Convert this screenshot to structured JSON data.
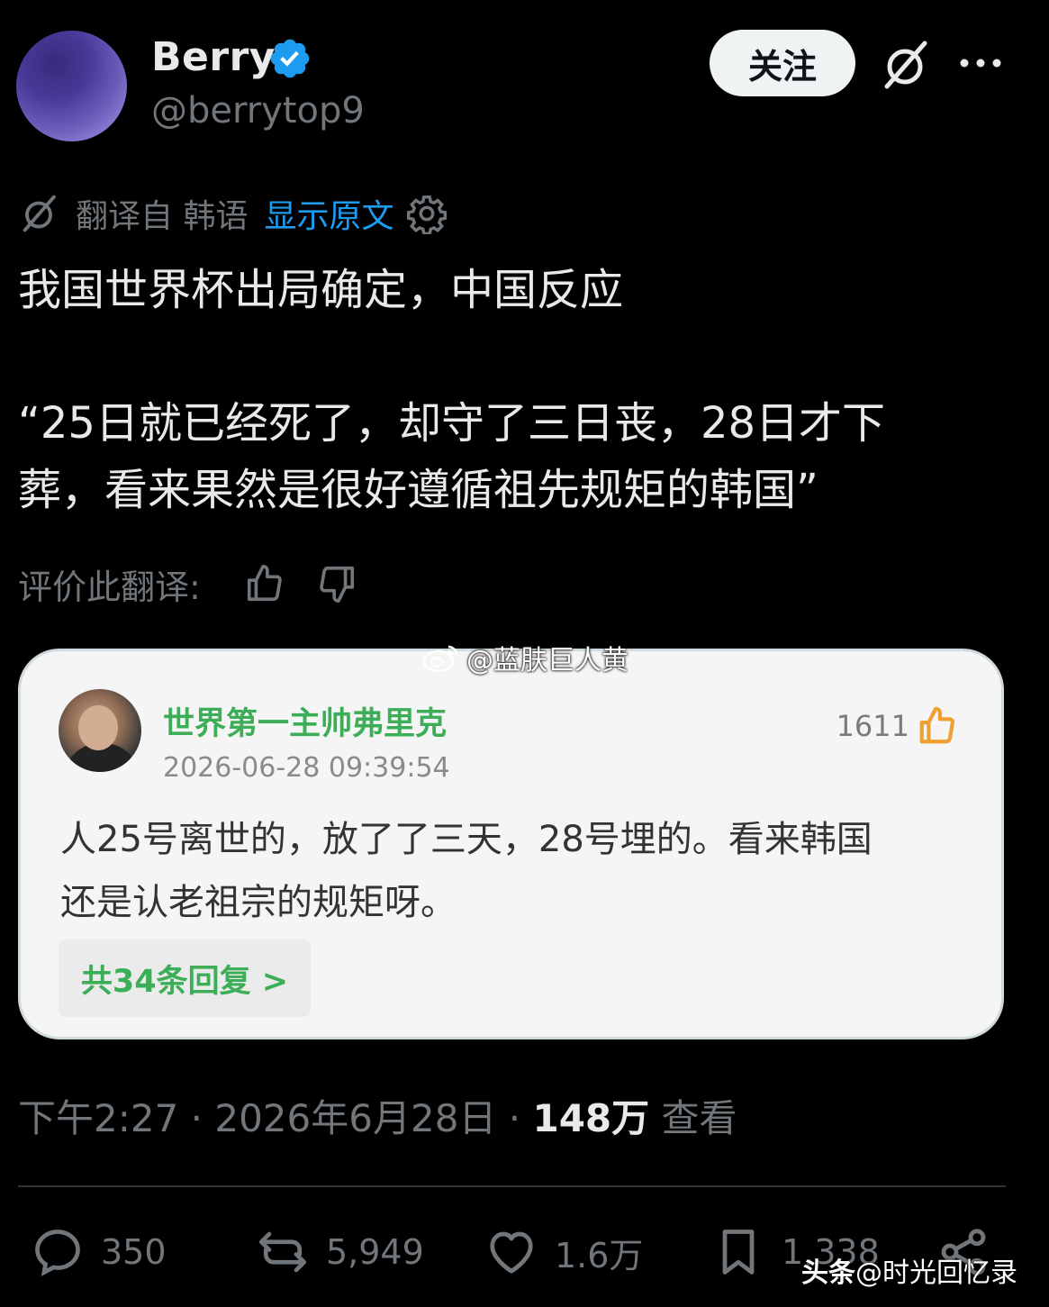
{
  "header": {
    "name": "Berry",
    "handle": "@berrytop9",
    "follow_label": "关注"
  },
  "translation": {
    "label": "翻译自 韩语",
    "show_original": "显示原文"
  },
  "tweet": {
    "lines": [
      "我国世界杯出局确定，中国反应",
      "“25日就已经死了，却守了三日丧，28日才下",
      "葬，看来果然是很好遵循祖先规矩的韩国”"
    ]
  },
  "rate": {
    "label": "评价此翻译:"
  },
  "card": {
    "username": "世界第一主帅弗里克",
    "time": "2026-06-28 09:39:54",
    "likes": "1611",
    "text_lines": [
      "人25号离世的，放了了三天，28号埋的。看来韩国",
      "还是认老祖宗的规矩呀。"
    ],
    "reply_label": "共34条回复 >"
  },
  "meta": {
    "time": "下午2:27 · 2026年6月28日 · ",
    "views": "148万",
    "views_label": " 查看"
  },
  "actions": {
    "replies": "350",
    "reposts": "5,949",
    "likes": "1.6万",
    "bookmarks": "1,338"
  },
  "watermarks": {
    "weibo": "@蓝肤巨人黄",
    "toutiao_brand": "头条",
    "toutiao_user": "@时光回忆录"
  },
  "colors": {
    "background": "#000000",
    "link_blue": "#1d9bf0",
    "muted": "#71767b",
    "card_green": "#3bae57",
    "like_orange": "#f0a030"
  }
}
